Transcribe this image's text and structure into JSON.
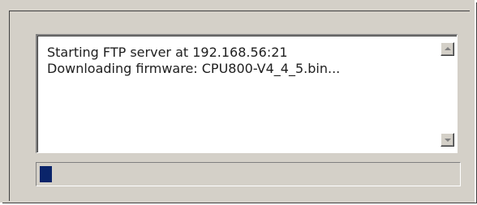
{
  "log": {
    "lines": [
      "Starting FTP server at 192.168.56:21",
      "Downloading firmware: CPU800-V4_4_5.bin..."
    ]
  },
  "progress": {
    "value_percent": 3
  },
  "icons": {
    "scroll_up": "scroll-up-arrow-icon",
    "scroll_down": "scroll-down-arrow-icon"
  },
  "colors": {
    "progress_fill": "#0a246a",
    "dialog_background": "#d4d0c8"
  }
}
